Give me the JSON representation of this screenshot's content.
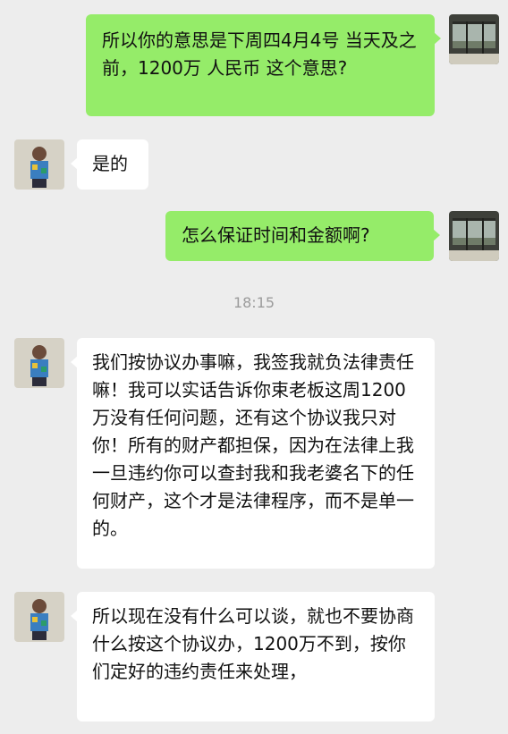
{
  "messages": [
    {
      "sender": "me",
      "text": "所以你的意思是下周四4月4号 当天及之前，1200万 人民币 这个意思?"
    },
    {
      "sender": "other",
      "text": "是的"
    },
    {
      "sender": "me",
      "text": "怎么保证时间和金额啊?"
    },
    {
      "sender": "other",
      "text": "我们按协议办事嘛，我签我就负法律责任嘛！我可以实话告诉你束老板这周1200万没有任何问题，还有这个协议我只对你！所有的财产都担保，因为在法律上我一旦违约你可以查封我和我老婆名下的任何财产，这个才是法律程序，而不是单一的。"
    },
    {
      "sender": "other",
      "text": "所以现在没有什么可以谈，就也不要协商什么按这个协议办，1200万不到，按你们定好的违约责任来处理，"
    }
  ],
  "timestamp": "18:15",
  "colors": {
    "background": "#ededed",
    "my_bubble": "#95ec69",
    "other_bubble": "#ffffff",
    "timestamp_text": "#9b9b9b"
  },
  "icons": {
    "my_avatar": "window-scene-avatar-icon",
    "other_avatar": "person-photo-avatar-icon"
  }
}
